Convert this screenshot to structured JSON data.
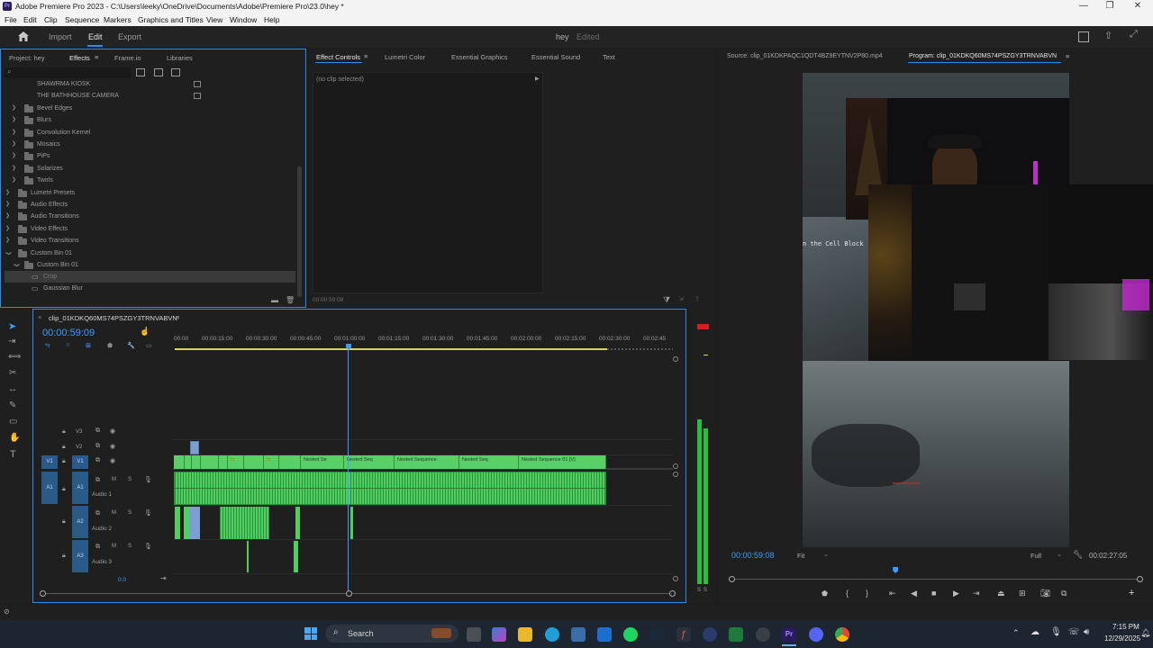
{
  "window": {
    "title": "Adobe Premiere Pro 2023 - C:\\Users\\leeky\\OneDrive\\Documents\\Adobe\\Premiere Pro\\23.0\\hey *",
    "app_icon": "Pr"
  },
  "menu": [
    "File",
    "Edit",
    "Clip",
    "Sequence",
    "Markers",
    "Graphics and Titles",
    "View",
    "Window",
    "Help"
  ],
  "workspace": {
    "tabs": [
      "Import",
      "Edit",
      "Export"
    ],
    "active": "Edit",
    "project_name": "hey",
    "project_status": "Edited"
  },
  "project_panel": {
    "tabs": [
      "Project: hey",
      "Effects",
      "Frame.io",
      "Libraries"
    ],
    "active_tab": "Effects",
    "items": [
      {
        "label": "SHAWRMA KIOSK",
        "type": "preset"
      },
      {
        "label": "THE BATHHOUSE CAMERA",
        "type": "preset"
      },
      {
        "label": "Bevel Edges",
        "type": "folder"
      },
      {
        "label": "Blurs",
        "type": "folder"
      },
      {
        "label": "Convolution Kernel",
        "type": "folder"
      },
      {
        "label": "Mosaics",
        "type": "folder"
      },
      {
        "label": "PiPs",
        "type": "folder"
      },
      {
        "label": "Solarizes",
        "type": "folder"
      },
      {
        "label": "Twirls",
        "type": "folder"
      },
      {
        "label": "Lumetri Presets",
        "type": "folder"
      },
      {
        "label": "Audio Effects",
        "type": "folder"
      },
      {
        "label": "Audio Transitions",
        "type": "folder"
      },
      {
        "label": "Video Effects",
        "type": "folder"
      },
      {
        "label": "Video Transitions",
        "type": "folder"
      },
      {
        "label": "Custom Bin 01",
        "type": "folder"
      },
      {
        "label": "Custom Bin 01",
        "type": "folder"
      },
      {
        "label": "Crop",
        "type": "effect",
        "selected": true
      },
      {
        "label": "Gaussian Blur",
        "type": "effect"
      }
    ]
  },
  "effect_controls": {
    "tabs": [
      "Effect Controls",
      "Lumetri Color",
      "Essential Graphics",
      "Essential Sound",
      "Text"
    ],
    "active_tab": "Effect Controls",
    "message": "(no clip selected)",
    "timecode": "00:00:59:08"
  },
  "source_monitor": {
    "label": "Source: clip_01KDKPAQC1QDT4BZ9EYTNV2P80.mp4"
  },
  "program_monitor": {
    "label": "Program: clip_01KDKQ60MS74PSZGY3TRNVABVN",
    "overlay_text": "n the Cell Block",
    "timecode": "00:00:59:08",
    "fit": "Fit",
    "resolution": "Full",
    "duration": "00:02:27:05",
    "playhead_fraction": 0.4
  },
  "timeline": {
    "sequence_name": "clip_01KDKQ60MS74PSZGY3TRNVABVN",
    "timecode": "00:00:59:09",
    "ruler": [
      "00:00",
      "00:00:15:00",
      "00:00:30:00",
      "00:00:45:00",
      "00:01:00:00",
      "00:01:15:00",
      "00:01:30:00",
      "00:01:45:00",
      "00:02:00:00",
      "00:02:15:00",
      "00:02:30:00",
      "00:02:45"
    ],
    "tracks": [
      {
        "id": "V3",
        "target": "",
        "name": ""
      },
      {
        "id": "V2",
        "target": "",
        "name": ""
      },
      {
        "id": "V1",
        "target": "V1",
        "name": ""
      },
      {
        "id": "A1",
        "target": "A1",
        "name": "Audio 1"
      },
      {
        "id": "A2",
        "target": "",
        "name": "Audio 2"
      },
      {
        "id": "A3",
        "target": "",
        "name": "Audio 3"
      }
    ],
    "master_level": "0.0",
    "clips_v1": [
      "fx",
      "fx",
      "Nested Se",
      "Nested Seq",
      "Nested Sequence",
      "Nested Seq",
      "Nested Sequence 01 [V]"
    ]
  },
  "meter_labels": [
    "S",
    "S"
  ],
  "taskbar": {
    "search": "Search",
    "time": "7:15 PM",
    "date": "12/29/2025"
  },
  "colors": {
    "accent_blue": "#2d8ceb",
    "clip_green": "#4fcf60",
    "track_target": "#2a5a88",
    "panel_bg": "#1f1f1f"
  }
}
